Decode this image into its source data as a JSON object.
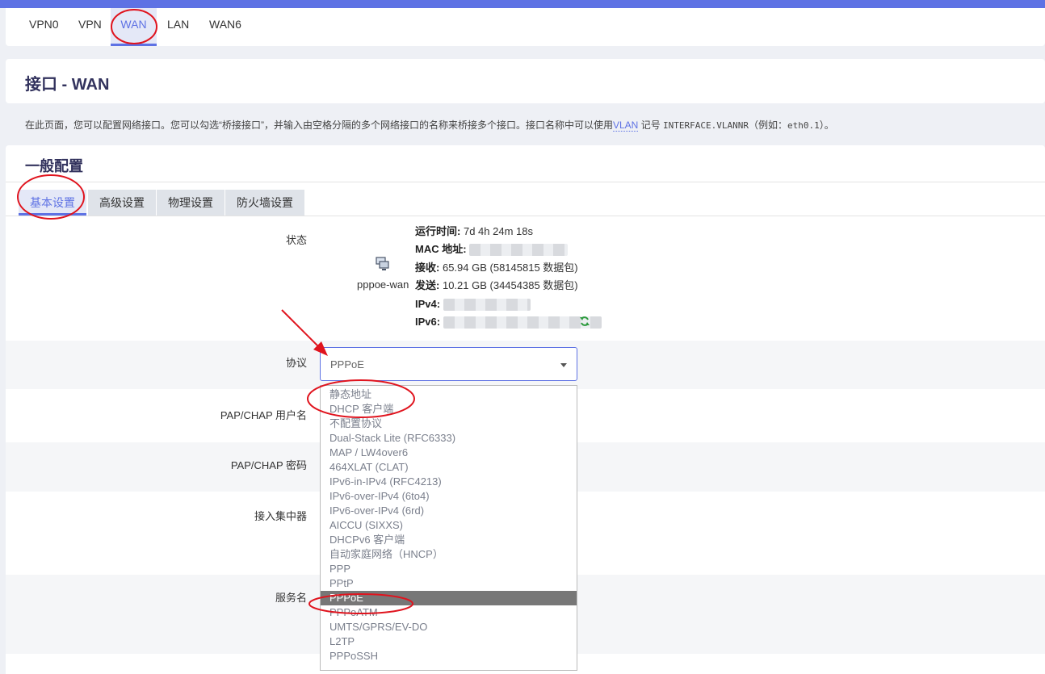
{
  "interface_tabs": [
    "VPN0",
    "VPN",
    "WAN",
    "LAN",
    "WAN6"
  ],
  "active_interface": "WAN",
  "page_title": "接口 - WAN",
  "description": {
    "part1": "在此页面，您可以配置网络接口。您可以勾选“桥接接口”，并输入由空格分隔的多个网络接口的名称来桥接多个接口。接口名称中可以使用",
    "vlan": "VLAN",
    "part2": " 记号 ",
    "code": "INTERFACE.VLANNR",
    "part3": "（例如：",
    "example": "eth0.1",
    "part4": "）。"
  },
  "section_title": "一般配置",
  "config_tabs": [
    "基本设置",
    "高级设置",
    "物理设置",
    "防火墙设置"
  ],
  "active_config_tab": "基本设置",
  "status": {
    "label": "状态",
    "device": "pppoe-wan",
    "uptime_label": "运行时间:",
    "uptime": "7d 4h 24m 18s",
    "mac_label": "MAC 地址:",
    "rx_label": "接收:",
    "rx": "65.94 GB (58145815 数据包)",
    "tx_label": "发送:",
    "tx": "10.21 GB (34454385 数据包)",
    "ipv4_label": "IPv4:",
    "ipv6_label": "IPv6:"
  },
  "fields": {
    "protocol_label": "协议",
    "protocol_value": "PPPoE",
    "username_label": "PAP/CHAP 用户名",
    "password_label": "PAP/CHAP 密码",
    "concentrator_label": "接入集中器",
    "service_label": "服务名"
  },
  "protocol_options": [
    "静态地址",
    "DHCP 客户端",
    "不配置协议",
    "Dual-Stack Lite (RFC6333)",
    "MAP / LW4over6",
    "464XLAT (CLAT)",
    "IPv6-in-IPv4 (RFC4213)",
    "IPv6-over-IPv4 (6to4)",
    "IPv6-over-IPv4 (6rd)",
    "AICCU (SIXXS)",
    "DHCPv6 客户端",
    "自动家庭网络（HNCP）",
    "PPP",
    "PPtP",
    "PPPoE",
    "PPPoATM",
    "UMTS/GPRS/EV-DO",
    "L2TP",
    "PPPoSSH"
  ],
  "selected_option": "PPPoE",
  "colors": {
    "accent": "#5e72e4",
    "annotation": "#e0141e"
  }
}
